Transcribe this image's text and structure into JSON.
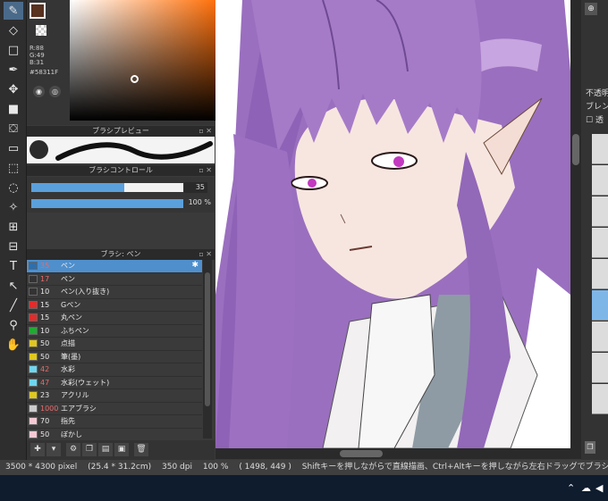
{
  "color_panel": {
    "r": "R:88",
    "g": "G:49",
    "b": "B:31",
    "hex": "#58311F",
    "fg_color": "#58311f"
  },
  "brush_preview": {
    "title": "ブラシプレビュー"
  },
  "brush_control": {
    "title": "ブラシコントロール",
    "size_value": "35",
    "size_fill": 0.61,
    "opacity_value": "100 %",
    "opacity_fill": 1.0
  },
  "brush_panel": {
    "title": "ブラシ: ペン",
    "items": [
      {
        "size": "35",
        "name": "ペン",
        "color": "#2d6fae",
        "selected": true
      },
      {
        "size": "17",
        "name": "ペン",
        "color": "#333333"
      },
      {
        "size": "10",
        "name": "ペン(入り抜き)",
        "color": "#333333"
      },
      {
        "size": "15",
        "name": "Gペン",
        "color": "#e32b2b"
      },
      {
        "size": "15",
        "name": "丸ペン",
        "color": "#e32b2b"
      },
      {
        "size": "10",
        "name": "ふちペン",
        "color": "#22aa33"
      },
      {
        "size": "50",
        "name": "点描",
        "color": "#e0c81e"
      },
      {
        "size": "50",
        "name": "筆(墨)",
        "color": "#e0c81e"
      },
      {
        "size": "42",
        "name": "水彩",
        "color": "#6fd6ef"
      },
      {
        "size": "47",
        "name": "水彩(ウェット)",
        "color": "#6fd6ef"
      },
      {
        "size": "23",
        "name": "アクリル",
        "color": "#e0c81e"
      },
      {
        "size": "1000",
        "name": "エアブラシ",
        "color": "#cccccc"
      },
      {
        "size": "70",
        "name": "指先",
        "color": "#f4c9d4"
      },
      {
        "size": "50",
        "name": "ぼかし",
        "color": "#f4c9d4"
      }
    ]
  },
  "layers": {
    "opacity_label": "不透明",
    "blend_label": "ブレンド",
    "protect_label": "透"
  },
  "status": {
    "canvas_size": "3500 * 4300 pixel",
    "physical_size": "(25.4 * 31.2cm)",
    "dpi": "350 dpi",
    "zoom": "100 %",
    "cursor": "( 1498, 449 )",
    "hint": "Shiftキーを押しながらで直線描画、Ctrl+Altキーを押しながら左右ドラッグでブラシサイズ変更"
  }
}
